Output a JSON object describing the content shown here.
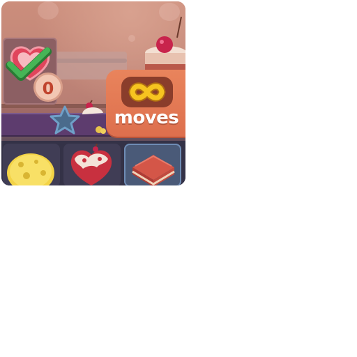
{
  "level_goal": {
    "target_icon": "heart-cookie-icon",
    "status_icon": "checkmark-icon",
    "remaining_count": "0"
  },
  "moves_badge": {
    "icon": "infinity-icon",
    "label": "moves"
  },
  "board": {
    "cells": [
      {
        "piece": "cheese-tile"
      },
      {
        "piece": "strawberry-cake-tile"
      },
      {
        "piece": "layer-cake-tile",
        "selected": true
      }
    ]
  },
  "colors": {
    "badge": "#dd6f4d",
    "badge_dark": "#8a3d2b",
    "infinity": "#f4c21e",
    "goal_count": "#c0442e",
    "checkmark": "#3aa84a"
  }
}
